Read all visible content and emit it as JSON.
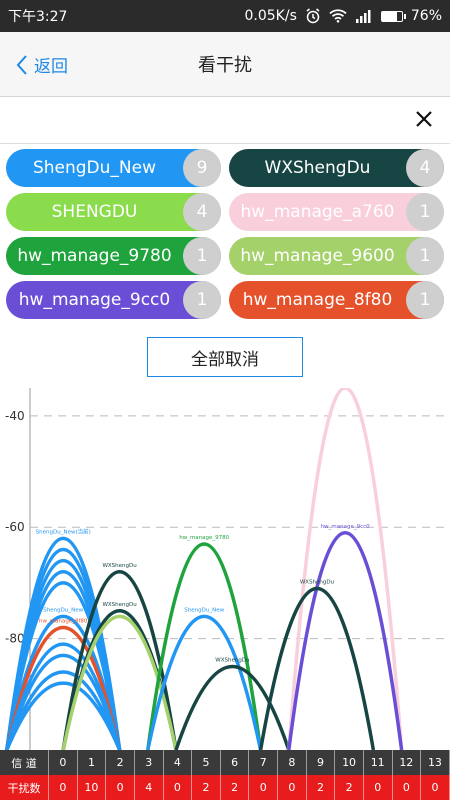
{
  "status": {
    "time": "下午3:27",
    "net_speed": "0.05K/s",
    "battery": "76%",
    "battery_level": 0.76
  },
  "header": {
    "back_label": "返回",
    "title": "看干扰"
  },
  "chips": [
    {
      "name": "ShengDu_New",
      "count": "9",
      "color": "#2196f3"
    },
    {
      "name": "WXShengDu",
      "count": "4",
      "color": "#174544"
    },
    {
      "name": "SHENGDU",
      "count": "4",
      "color": "#8bdc4c"
    },
    {
      "name": "hw_manage_a760",
      "count": "1",
      "color": "#f9cfdc"
    },
    {
      "name": "hw_manage_9780",
      "count": "1",
      "color": "#1fa33c"
    },
    {
      "name": "hw_manage_9600",
      "count": "1",
      "color": "#a5d16b"
    },
    {
      "name": "hw_manage_9cc0",
      "count": "1",
      "color": "#6a4fd6"
    },
    {
      "name": "hw_manage_8f80",
      "count": "1",
      "color": "#e5512a"
    }
  ],
  "cancel_all_label": "全部取消",
  "chart_data": {
    "type": "line",
    "y_ticks": [
      "-40",
      "-60",
      "-80"
    ],
    "ylim": [
      -100,
      -35
    ],
    "channels": [
      0,
      1,
      2,
      3,
      4,
      5,
      6,
      7,
      8,
      9,
      10,
      11,
      12,
      13
    ],
    "series": [
      {
        "name": "ShengDu_New(当前)",
        "color": "#2196f3",
        "center": 1,
        "peak": -62,
        "labeled": true
      },
      {
        "name": "",
        "color": "#2196f3",
        "center": 1,
        "peak": -64
      },
      {
        "name": "",
        "color": "#2196f3",
        "center": 1,
        "peak": -66
      },
      {
        "name": "",
        "color": "#2196f3",
        "center": 1,
        "peak": -68
      },
      {
        "name": "",
        "color": "#2196f3",
        "center": 1,
        "peak": -70
      },
      {
        "name": "ShengDu_New",
        "color": "#2196f3",
        "center": 1,
        "peak": -76,
        "labeled": true
      },
      {
        "name": "hw_manage_8f80",
        "color": "#e5512a",
        "center": 1,
        "peak": -78,
        "labeled": true
      },
      {
        "name": "",
        "color": "#2196f3",
        "center": 1,
        "peak": -81
      },
      {
        "name": "",
        "color": "#2196f3",
        "center": 1,
        "peak": -83
      },
      {
        "name": "",
        "color": "#2196f3",
        "center": 1,
        "peak": -86
      },
      {
        "name": "",
        "color": "#2196f3",
        "center": 1,
        "peak": -88
      },
      {
        "name": "WXShengDu",
        "color": "#174544",
        "center": 3,
        "peak": -68,
        "labeled": true
      },
      {
        "name": "WXShengDu",
        "color": "#174544",
        "center": 3,
        "peak": -75,
        "labeled": true
      },
      {
        "name": "",
        "color": "#a5d16b",
        "center": 3,
        "peak": -76
      },
      {
        "name": "hw_manage_9780",
        "color": "#1fa33c",
        "center": 6,
        "peak": -63,
        "labeled": true
      },
      {
        "name": "ShengDu_New",
        "color": "#2196f3",
        "center": 6,
        "peak": -76,
        "labeled": true
      },
      {
        "name": "WXShengDu",
        "color": "#174544",
        "center": 7,
        "peak": -85,
        "labeled": true
      },
      {
        "name": "",
        "color": "#f9cfdc",
        "center": 11,
        "peak": -35
      },
      {
        "name": "hw_manage_9cc0",
        "color": "#6a4fd6",
        "center": 11,
        "peak": -61,
        "labeled": true
      },
      {
        "name": "WXShengDu",
        "color": "#174544",
        "center": 10,
        "peak": -71,
        "labeled": true
      }
    ]
  },
  "axis_rows": {
    "channel_label": "信 道",
    "interference_label": "干扰数",
    "channels": [
      "0",
      "1",
      "2",
      "3",
      "4",
      "5",
      "6",
      "7",
      "8",
      "9",
      "10",
      "11",
      "12",
      "13"
    ],
    "counts": [
      "0",
      "10",
      "0",
      "4",
      "0",
      "2",
      "2",
      "0",
      "0",
      "2",
      "2",
      "0",
      "0",
      "0"
    ],
    "channel_row_color": "#3a3a3a",
    "count_row_color": "#e81c1c"
  }
}
